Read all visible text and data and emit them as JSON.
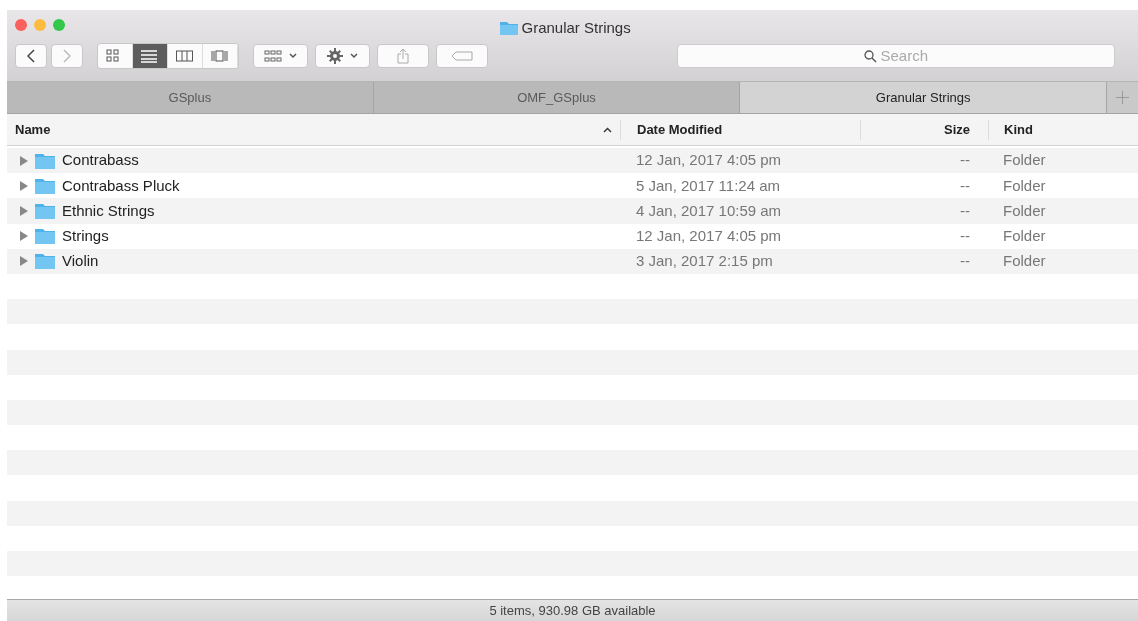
{
  "window": {
    "title": "Granular Strings"
  },
  "toolbar": {
    "view_modes": [
      {
        "kind": "icons",
        "selected": false
      },
      {
        "kind": "list",
        "selected": true
      },
      {
        "kind": "columns",
        "selected": false
      },
      {
        "kind": "coverflow",
        "selected": false
      }
    ],
    "search": {
      "placeholder": "Search"
    }
  },
  "tabs": [
    {
      "label": "GSplus",
      "selected": false
    },
    {
      "label": "OMF_GSplus",
      "selected": false
    },
    {
      "label": "Granular Strings",
      "selected": true
    }
  ],
  "table": {
    "columns": [
      {
        "label": "Name",
        "sorted": true
      },
      {
        "label": "Date Modified",
        "sorted": false
      },
      {
        "label": "Size",
        "sorted": false
      },
      {
        "label": "Kind",
        "sorted": false
      }
    ],
    "rows": [
      {
        "name": "Contrabass",
        "date": "12 Jan, 2017 4:05 pm",
        "size": "--",
        "kind": "Folder",
        "expanded": false
      },
      {
        "name": "Contrabass Pluck",
        "date": "5 Jan, 2017 11:24 am",
        "size": "--",
        "kind": "Folder",
        "expanded": false
      },
      {
        "name": "Ethnic Strings",
        "date": "4 Jan, 2017 10:59 am",
        "size": "--",
        "kind": "Folder",
        "expanded": false
      },
      {
        "name": "Strings",
        "date": "12 Jan, 2017 4:05 pm",
        "size": "--",
        "kind": "Folder",
        "expanded": false
      },
      {
        "name": "Violin",
        "date": "3 Jan, 2017 2:15 pm",
        "size": "--",
        "kind": "Folder",
        "expanded": false
      }
    ]
  },
  "status_bar": "5 items, 930.98 GB available"
}
